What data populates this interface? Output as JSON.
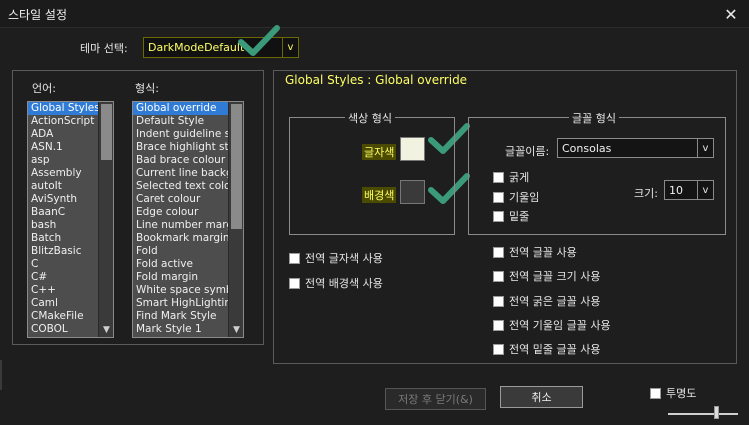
{
  "window": {
    "title": "스타일 설정"
  },
  "theme": {
    "label": "테마 선택:",
    "value": "DarkModeDefault"
  },
  "language_list": {
    "header": "언어:",
    "items": [
      "Global Styles",
      "ActionScript",
      "ADA",
      "ASN.1",
      "asp",
      "Assembly",
      "autoIt",
      "AviSynth",
      "BaanC",
      "bash",
      "Batch",
      "BlitzBasic",
      "C",
      "C#",
      "C++",
      "Caml",
      "CMakeFile",
      "COBOL"
    ],
    "selected": "Global Styles"
  },
  "style_list": {
    "header": "형식:",
    "items": [
      "Global override",
      "Default Style",
      "Indent guideline style",
      "Brace highlight style",
      "Bad brace colour",
      "Current line background",
      "Selected text colour",
      "Caret colour",
      "Edge colour",
      "Line number margin",
      "Bookmark margin",
      "Fold",
      "Fold active",
      "Fold margin",
      "White space symbol",
      "Smart HighLighting",
      "Find Mark Style",
      "Mark Style 1"
    ],
    "selected": "Global override"
  },
  "panel": {
    "title": "Global Styles : Global override"
  },
  "color_style": {
    "legend": "색상 형식",
    "foreground_label": "글자색",
    "background_label": "배경색",
    "foreground_color": "#f2f2e0",
    "background_color": "#3a3a3a"
  },
  "font_style": {
    "legend": "글꼴 형식",
    "font_name_label": "글꼴이름:",
    "font_name": "Consolas",
    "bold_label": "굵게",
    "italic_label": "기울임",
    "underline_label": "밑줄",
    "size_label": "크기:",
    "size": "10"
  },
  "global_options": {
    "fg": "전역 글자색 사용",
    "bg": "전역 배경색 사용",
    "font": "전역 글꼴 사용",
    "font_size": "전역 글꼴 크기 사용",
    "bold": "전역 굵은 글꼴 사용",
    "italic": "전역 기울임 글꼴 사용",
    "underline": "전역 밑줄 글꼴 사용"
  },
  "buttons": {
    "save_close": "저장 후 닫기(&)",
    "cancel": "취소"
  },
  "transparency": {
    "label": "투명도",
    "level": 0.7
  },
  "colors": {
    "accent_yellow": "#ffff66",
    "checkmark": "#3a9a7a",
    "selection": "#2f7bd6"
  }
}
